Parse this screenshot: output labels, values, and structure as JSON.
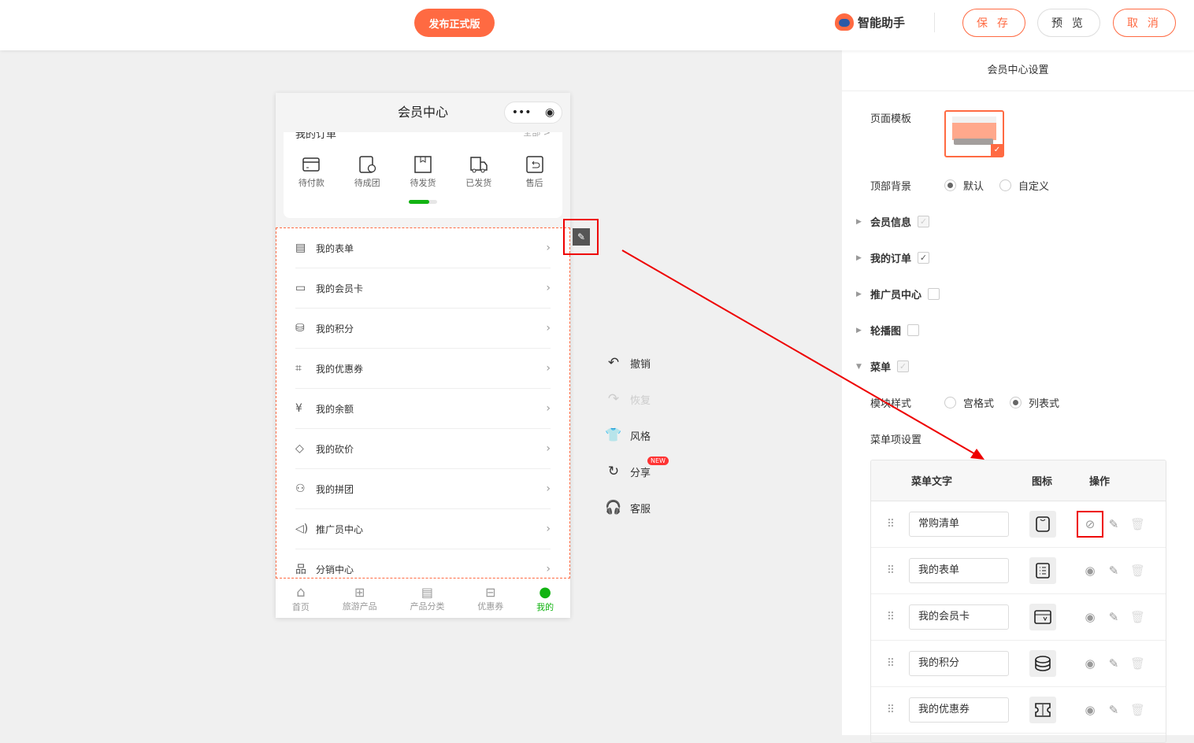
{
  "header": {
    "publish": "发布正式版",
    "assistant": "智能助手",
    "save": "保 存",
    "preview": "预 览",
    "cancel": "取 消"
  },
  "phone": {
    "title": "会员中心",
    "capsule_more": "•••",
    "order_title": "我的订单",
    "order_all": "全部 >",
    "order_items": [
      "待付款",
      "待成团",
      "待发货",
      "已发货",
      "售后"
    ],
    "order_progress": 0.72,
    "menu": [
      "我的表单",
      "我的会员卡",
      "我的积分",
      "我的优惠券",
      "我的余额",
      "我的砍价",
      "我的拼团",
      "推广员中心",
      "分销中心"
    ],
    "tabs": [
      "首页",
      "旅游产品",
      "产品分类",
      "优惠券",
      "我的"
    ]
  },
  "tools": {
    "undo": "撤销",
    "redo": "恢复",
    "style": "风格",
    "share": "分享",
    "share_badge": "NEW",
    "service": "客服"
  },
  "panel": {
    "title": "会员中心设置",
    "template_label": "页面模板",
    "bg_label": "顶部背景",
    "bg_options": [
      "默认",
      "自定义"
    ],
    "bg_selected": "默认",
    "sections": [
      {
        "label": "会员信息",
        "checked": true,
        "disabled": true
      },
      {
        "label": "我的订单",
        "checked": true,
        "disabled": false
      },
      {
        "label": "推广员中心",
        "checked": false,
        "disabled": false
      },
      {
        "label": "轮播图",
        "checked": false,
        "disabled": false
      },
      {
        "label": "菜单",
        "checked": true,
        "disabled": true
      }
    ],
    "style_label": "模块样式",
    "style_options": [
      "宫格式",
      "列表式"
    ],
    "style_selected": "列表式",
    "items_label": "菜单项设置",
    "table": {
      "headers": [
        "菜单文字",
        "图标",
        "操作"
      ],
      "rows": [
        {
          "text": "常购清单",
          "visible": false
        },
        {
          "text": "我的表单",
          "visible": true
        },
        {
          "text": "我的会员卡",
          "visible": true
        },
        {
          "text": "我的积分",
          "visible": true
        },
        {
          "text": "我的优惠券",
          "visible": true
        }
      ]
    }
  },
  "colors": {
    "accent": "#ff6a42",
    "green": "#12b312",
    "highlight": "#e00000"
  }
}
